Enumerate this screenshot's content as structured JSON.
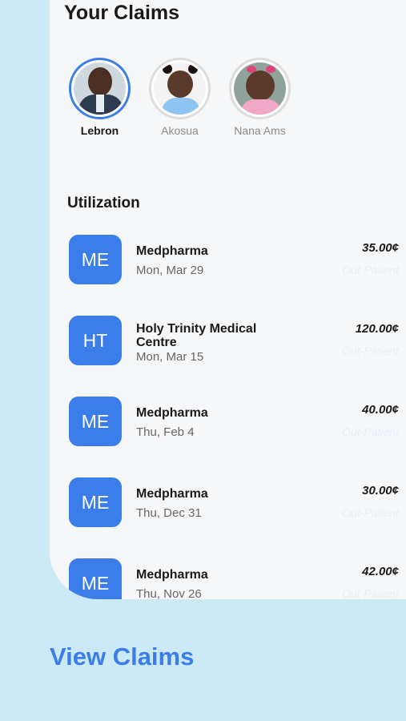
{
  "header": {
    "title": "Your Claims"
  },
  "members": [
    {
      "name": "Lebron",
      "selected": true
    },
    {
      "name": "Akosua",
      "selected": false
    },
    {
      "name": "Nana Ams",
      "selected": false
    }
  ],
  "utilization": {
    "title": "Utilization",
    "items": [
      {
        "initials": "ME",
        "provider": "Medpharma",
        "date": "Mon, Mar 29",
        "amount": "35.00¢",
        "type": "Out-Patient"
      },
      {
        "initials": "HT",
        "provider": "Holy Trinity Medical Centre",
        "date": "Mon, Mar 15",
        "amount": "120.00¢",
        "type": "Out-Patient"
      },
      {
        "initials": "ME",
        "provider": "Medpharma",
        "date": "Thu, Feb 4",
        "amount": "40.00¢",
        "type": "Out-Patient"
      },
      {
        "initials": "ME",
        "provider": "Medpharma",
        "date": "Thu, Dec 31",
        "amount": "30.00¢",
        "type": "Out-Patient"
      },
      {
        "initials": "ME",
        "provider": "Medpharma",
        "date": "Thu, Nov 26",
        "amount": "42.00¢",
        "type": "Out-Patient"
      }
    ]
  },
  "cta": {
    "label": "View Claims"
  },
  "colors": {
    "accent": "#3b7de9",
    "background": "#cbeaf6",
    "card": "#f6f7f9"
  }
}
